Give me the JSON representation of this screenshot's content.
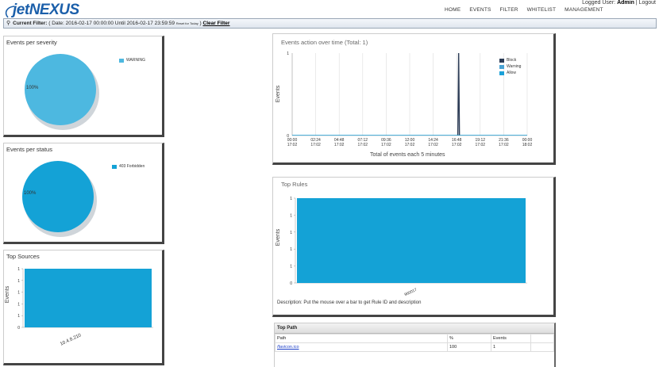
{
  "logo": {
    "part1": "jet",
    "part2": "NEXUS"
  },
  "user": {
    "prefix": "Logged User:",
    "name": "Admin",
    "separator": "|",
    "logout": "Logout"
  },
  "nav": [
    "HOME",
    "EVENTS",
    "FILTER",
    "WHITELIST",
    "MANAGEMENT"
  ],
  "filter": {
    "label": "Current Filter:",
    "text": "( Date: 2016-02-17 00:00:00 Until 2016-02-17 23:59:59",
    "reset": "Reset for Today",
    "close_paren": ")",
    "clear": "Clear Filter"
  },
  "severity_panel": {
    "title": "Events per severity",
    "pct_label": "100%",
    "legend": "WARNING"
  },
  "status_panel": {
    "title": "Events per status",
    "pct_label": "100%",
    "legend": "403 Forbidden"
  },
  "sources_panel": {
    "title": "Top Sources",
    "y_title": "Events",
    "category": "10.4.8.210"
  },
  "timeline_panel": {
    "title": "Events action over time (Total: 1)",
    "y_title": "Events",
    "x_title": "Total of events each 5 minutes",
    "legend": [
      "Block",
      "Warning",
      "Allow"
    ]
  },
  "rules_panel": {
    "title": "Top Rules",
    "y_title": "Events",
    "category": "960017",
    "description": "Description: Put the mouse over a bar to get Rule ID and description"
  },
  "top_path": {
    "title": "Top Path",
    "columns": [
      "Path",
      "%",
      "Events"
    ],
    "rows": [
      {
        "path": "/favicon.ico",
        "pct": "100",
        "events": "1"
      }
    ]
  },
  "colors": {
    "accent": "#4db8e0",
    "bar": "#14a2d6",
    "block": "#2b3b55",
    "warning": "#4aa3d4",
    "allow": "#1ba1d8"
  },
  "chart_data": [
    {
      "type": "pie",
      "title": "Events per severity",
      "labels": [
        "WARNING"
      ],
      "values": [
        100
      ]
    },
    {
      "type": "pie",
      "title": "Events per status",
      "labels": [
        "403 Forbidden"
      ],
      "values": [
        100
      ]
    },
    {
      "type": "bar",
      "title": "Top Sources",
      "categories": [
        "10.4.8.210"
      ],
      "values": [
        1
      ],
      "ylabel": "Events",
      "yticks": [
        "0",
        "1",
        "1",
        "1",
        "1",
        "1"
      ],
      "ylim": [
        0,
        1
      ]
    },
    {
      "type": "line",
      "title": "Events action over time (Total: 1)",
      "xlabel": "Total of events each 5 minutes",
      "ylabel": "Events",
      "x_ticks": [
        [
          "00:00",
          "17:02"
        ],
        [
          "02:24",
          "17:02"
        ],
        [
          "04:48",
          "17:02"
        ],
        [
          "07:12",
          "17:02"
        ],
        [
          "09:36",
          "17:02"
        ],
        [
          "12:00",
          "17:02"
        ],
        [
          "14:24",
          "17:02"
        ],
        [
          "16:48",
          "17:02"
        ],
        [
          "19:12",
          "17:02"
        ],
        [
          "21:36",
          "17:02"
        ],
        [
          "00:00",
          "18:02"
        ]
      ],
      "y_ticks": [
        "0",
        "1"
      ],
      "ylim": [
        0,
        1
      ],
      "series": [
        {
          "name": "Block",
          "spike_at": "17:00",
          "value": 1
        },
        {
          "name": "Warning",
          "value": 0
        },
        {
          "name": "Allow",
          "value": 0
        }
      ]
    },
    {
      "type": "bar",
      "title": "Top Rules",
      "categories": [
        "960017"
      ],
      "values": [
        1
      ],
      "ylabel": "Events",
      "yticks": [
        "0",
        "1",
        "1",
        "1",
        "1",
        "1"
      ],
      "ylim": [
        0,
        1
      ]
    }
  ]
}
